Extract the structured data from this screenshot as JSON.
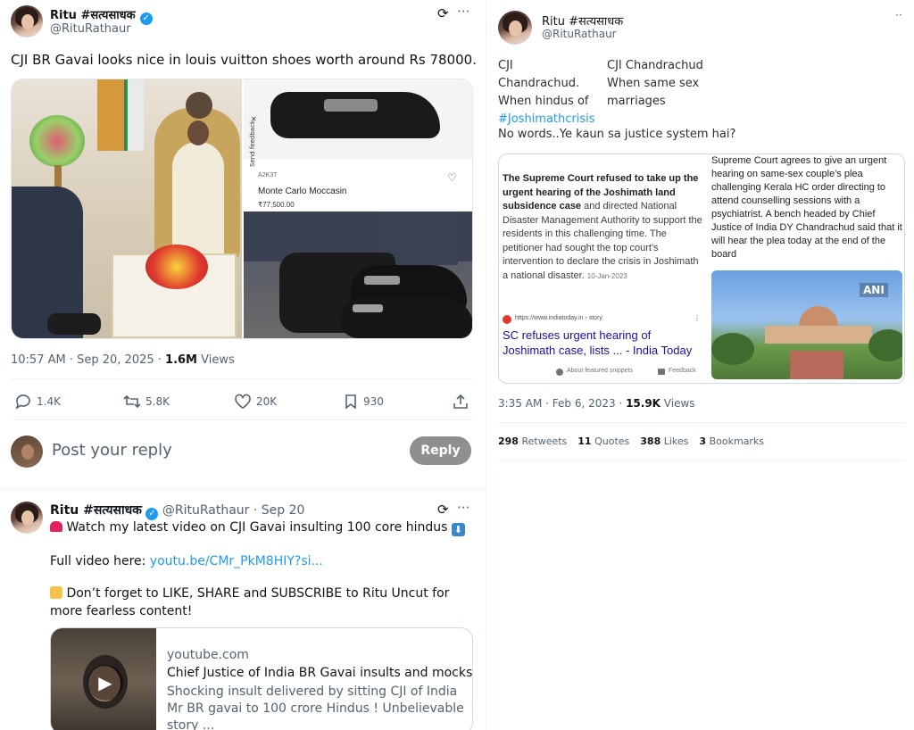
{
  "tweet1": {
    "name": "Ritu #सत्यसाधक",
    "handle": "@RituRathaur",
    "text": "CJI BR Gavai looks nice in louis vuitton shoes worth around Rs 78000.",
    "time": "10:57 AM · Sep 20, 2025 · ",
    "views_num": "1.6M",
    "views_label": " Views",
    "product": {
      "code": "A2K3T",
      "name": "Monte Carlo Moccasin",
      "price": "₹77,500.00",
      "feedback": "Send feedback"
    },
    "stats": {
      "replies": "1.4K",
      "retweets": "5.8K",
      "likes": "20K",
      "bookmarks": "930"
    },
    "reply_placeholder": "Post your reply",
    "reply_button": "Reply"
  },
  "tweet2": {
    "name": "Ritu #सत्यसाधक",
    "handle": "@RituRathaur",
    "date": " · Sep 20",
    "line1": "Watch my latest  video  on CJI Gavai insulting 100 core hindus",
    "full_label": "Full video here: ",
    "full_link": "youtu.be/CMr_PkM8HIY?si...",
    "line3": "Don’t forget to LIKE, SHARE and SUBSCRIBE to Ritu Uncut for more fearless content!",
    "card": {
      "domain": "youtube.com",
      "title": "Chief Justice of India BR Gavai insults and mocks L...",
      "desc": "Shocking insult delivered by sitting CJI of India Mr BR gavai to 100 crore Hindus ! Unbelievable story ..."
    }
  },
  "tweet3": {
    "name": "Ritu #सत्यसाधक",
    "handle": "@RituRathaur",
    "col1": [
      "CJI Chandrachud.",
      "When hindus of",
      "#Joshimathcrisis"
    ],
    "col2": [
      "CJI Chandrachud",
      "When same sex",
      "marriages"
    ],
    "line2": "No words..Ye kaun sa justice system hai?",
    "left_snip": {
      "bold": "The Supreme Court refused to take up the urgent hearing of the Joshimath land subsidence case",
      "rest": " and directed National Disaster Management Authority to support the residents in this challenging time. The petitioner had sought the top court's intervention to declare the crisis in Joshimath a national disaster.",
      "date": "10-Jan-2023",
      "source": "https://www.indiatoday.in › story",
      "headline": "SC refuses urgent hearing of Joshimath case, lists ... - India Today",
      "about": "About featured snippets",
      "feedback": "Feedback"
    },
    "right_snip": {
      "text": "Supreme Court agrees to give an urgent hearing on same-sex couple's plea challenging Kerala HC order directing to attend counselling sessions with a psychiatrist. A bench headed by Chief Justice of India DY Chandrachud said that it will hear the plea today at the end of the board",
      "badge": "ANI"
    },
    "time": "3:35 AM · Feb 6, 2023 · ",
    "views_num": "15.9K",
    "views_label": " Views",
    "stats": [
      {
        "num": "298",
        "label": "Retweets"
      },
      {
        "num": "11",
        "label": "Quotes"
      },
      {
        "num": "388",
        "label": "Likes"
      },
      {
        "num": "3",
        "label": "Bookmarks"
      }
    ]
  }
}
